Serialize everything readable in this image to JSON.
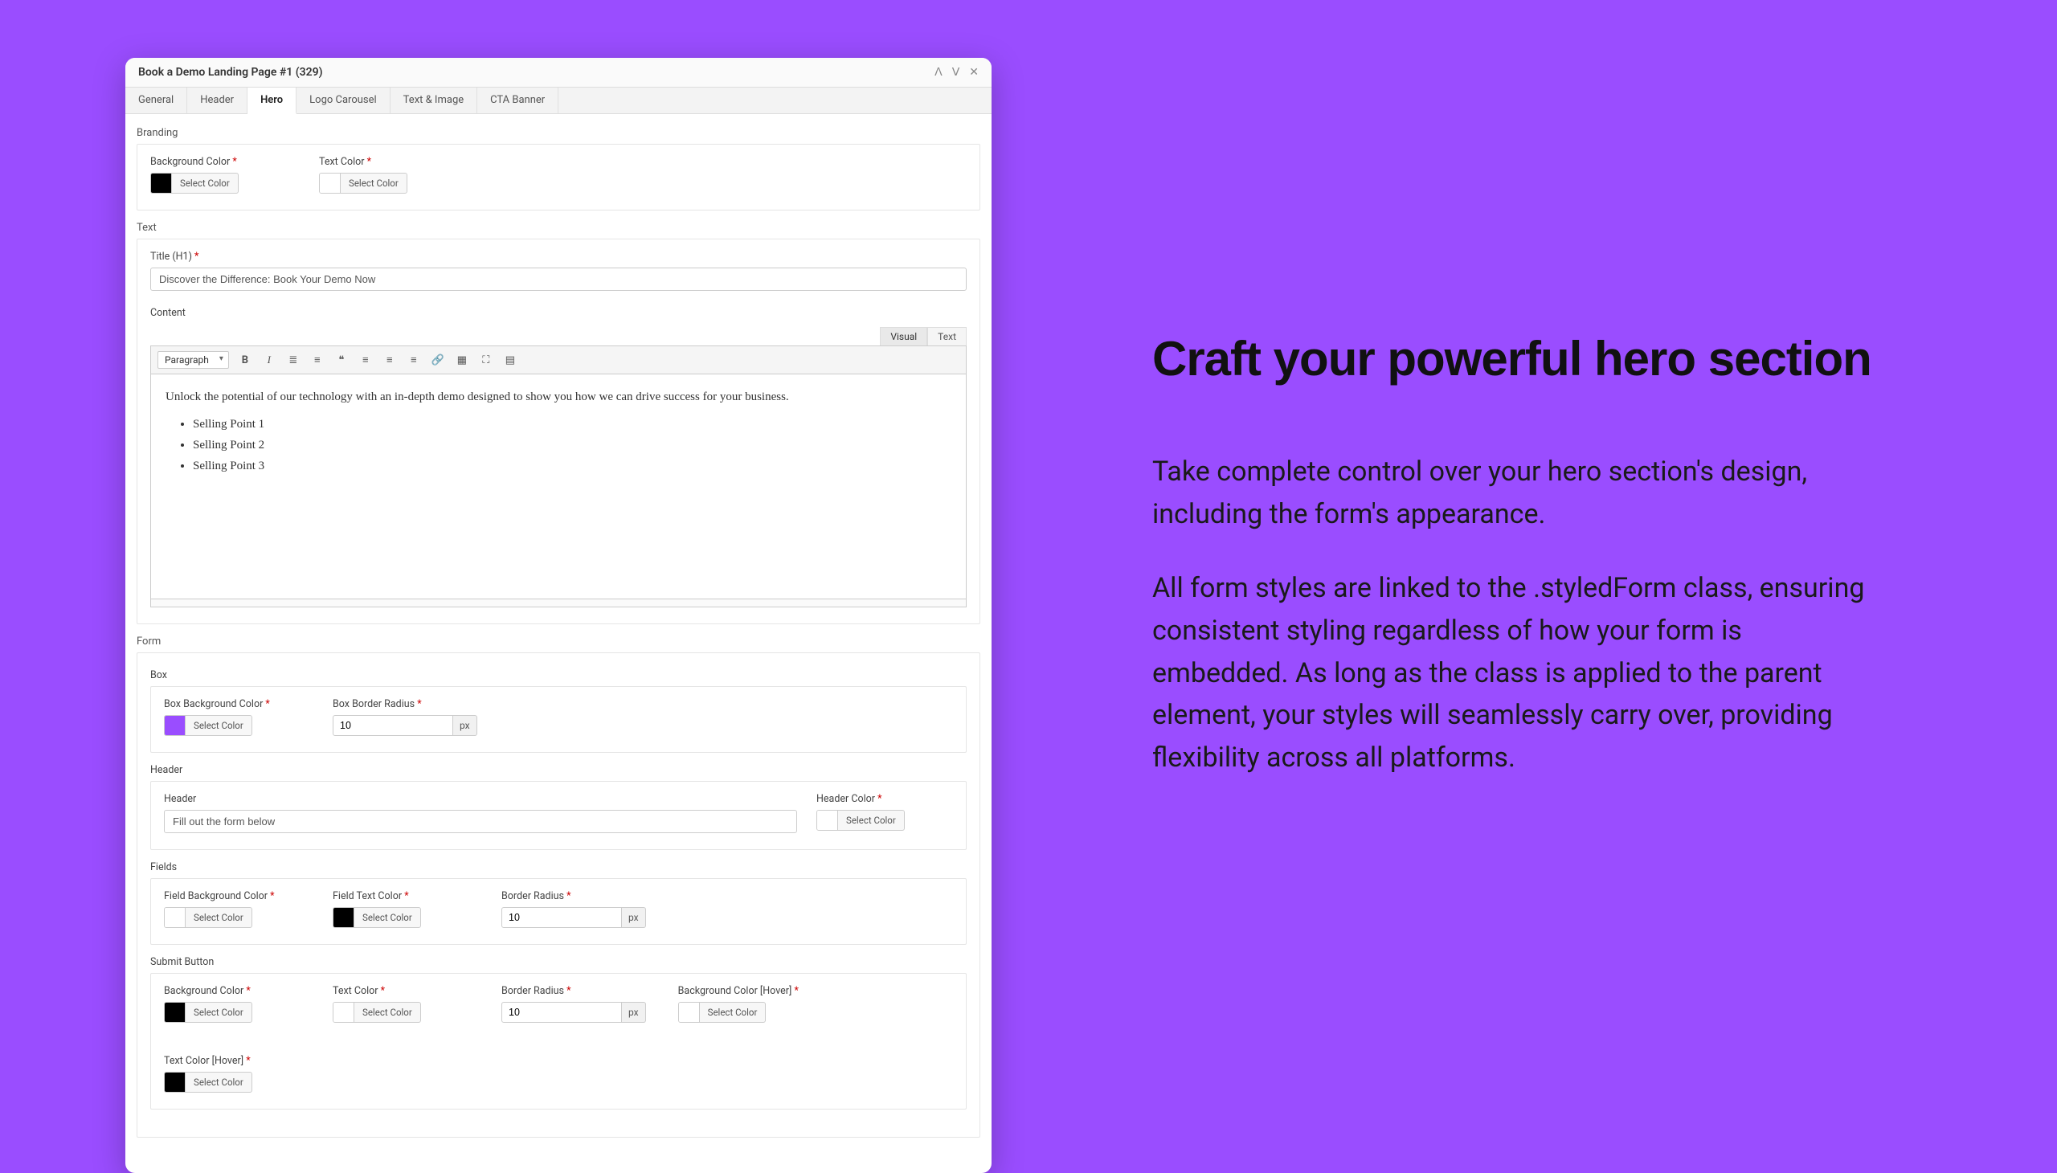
{
  "panel": {
    "title": "Book a Demo Landing Page #1 (329)",
    "tabs": [
      "General",
      "Header",
      "Hero",
      "Logo Carousel",
      "Text & Image",
      "CTA Banner"
    ],
    "activeTab": 2
  },
  "branding": {
    "section": "Branding",
    "bgLabel": "Background Color",
    "textLabel": "Text Color",
    "selectColor": "Select Color"
  },
  "text": {
    "section": "Text",
    "titleLabel": "Title (H1)",
    "title": "Discover the Difference: Book Your Demo Now",
    "contentLabel": "Content",
    "para": "Paragraph",
    "visual": "Visual",
    "textTab": "Text",
    "body": "Unlock the potential of our technology with an in-depth demo designed to show you how we can drive success for your business.",
    "sp1": "Selling Point 1",
    "sp2": "Selling Point 2",
    "sp3": "Selling Point 3"
  },
  "form": {
    "section": "Form",
    "box": {
      "label": "Box",
      "bgLabel": "Box Background Color",
      "radiusLabel": "Box Border Radius",
      "radius": "10",
      "unit": "px"
    },
    "header": {
      "label": "Header",
      "headerLabel": "Header",
      "headerValue": "Fill out the form below",
      "colorLabel": "Header Color"
    },
    "fields": {
      "label": "Fields",
      "bgLabel": "Field Background Color",
      "textLabel": "Field Text Color",
      "radiusLabel": "Border Radius",
      "radius": "10",
      "unit": "px"
    },
    "submit": {
      "label": "Submit Button",
      "bgLabel": "Background Color",
      "textLabel": "Text Color",
      "radiusLabel": "Border Radius",
      "radius": "10",
      "unit": "px",
      "bgHoverLabel": "Background Color [Hover]",
      "textHoverLabel": "Text Color [Hover]"
    }
  },
  "copy": {
    "heading": "Craft your powerful hero section",
    "p1": "Take complete control over your hero section's design, including the form's appearance.",
    "p2": "All form styles are linked to the .styledForm class, ensuring consistent styling regardless of how your form is embedded. As long as the class is applied to the parent element, your styles will seamlessly carry over, providing flexibility across all platforms."
  }
}
